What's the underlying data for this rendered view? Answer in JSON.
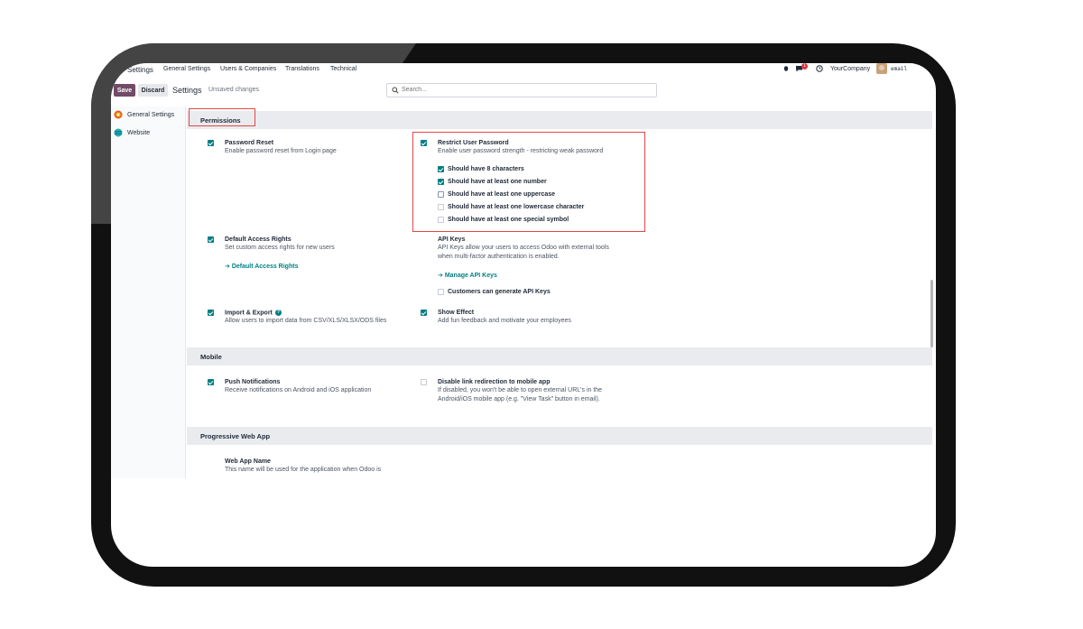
{
  "topnav": {
    "app": "Settings",
    "items": [
      "General Settings",
      "Users & Companies",
      "Translations",
      "Technical"
    ],
    "badge": "1",
    "company": "YourCompany",
    "user_email": "email"
  },
  "controls": {
    "save": "Save",
    "discard": "Discard",
    "breadcrumb": "Settings",
    "unsaved": "Unsaved changes",
    "search_placeholder": "Search..."
  },
  "sidebar": {
    "items": [
      "General Settings",
      "Website"
    ]
  },
  "sections": {
    "permissions": "Permissions",
    "mobile": "Mobile",
    "pwa": "Progressive Web App"
  },
  "settings": {
    "password_reset": {
      "title": "Password Reset",
      "desc": "Enable password reset from Login page"
    },
    "restrict_password": {
      "title": "Restrict User Password",
      "desc": "Enable user password strength - restricting weak password",
      "options": [
        {
          "label": "Should have 8 characters",
          "checked": true
        },
        {
          "label": "Should have at least one number",
          "checked": true
        },
        {
          "label": "Should have at least one uppercase",
          "checked": false
        },
        {
          "label": "Should have at least one lowercase character",
          "checked": false
        },
        {
          "label": "Should have at least one special symbol",
          "checked": false
        }
      ]
    },
    "default_access": {
      "title": "Default Access Rights",
      "desc": "Set custom access rights for new users",
      "link": "Default Access Rights"
    },
    "api_keys": {
      "title": "API Keys",
      "desc1": "API Keys allow your users to access Odoo with external tools",
      "desc2": "when multi-factor authentication is enabled.",
      "link": "Manage API Keys",
      "option": "Customers can generate API Keys"
    },
    "import_export": {
      "title": "Import & Export",
      "desc": "Allow users to import data from CSV/XLS/XLSX/ODS files"
    },
    "show_effect": {
      "title": "Show Effect",
      "desc": "Add fun feedback and motivate your employees"
    },
    "push_notifications": {
      "title": "Push Notifications",
      "desc": "Receive notifications on Android and iOS application"
    },
    "disable_redirect": {
      "title": "Disable link redirection to mobile app",
      "desc1": "If disabled, you won't be able to open external URL's in the",
      "desc2": "Android/iOS mobile app (e.g. \"View Task\" button in email)."
    },
    "web_app_name": {
      "title": "Web App Name",
      "desc": "This name will be used for the application when Odoo is"
    }
  },
  "colors": {
    "primary": "#714b67",
    "accent": "#017e84",
    "highlight": "#e04848"
  }
}
